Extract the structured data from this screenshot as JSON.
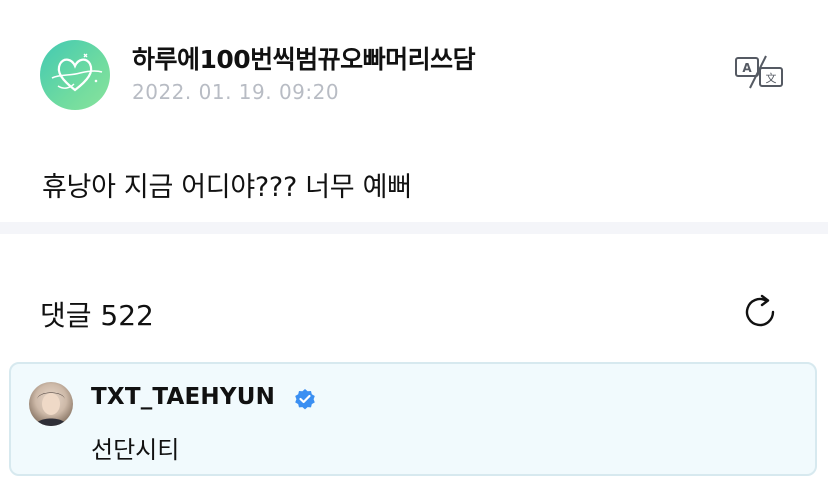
{
  "post": {
    "author": "하루에100번씩범뀨오빠머리쓰담",
    "date": "2022. 01. 19. 09:20",
    "body": "휴낭아 지금 어디야??? 너무 예뻐",
    "translate_icon": "translate-icon"
  },
  "comments": {
    "title": "댓글 522",
    "refresh_icon": "refresh-icon",
    "items": [
      {
        "author": "TXT_TAEHYUN",
        "verified": true,
        "text": "선단시티"
      }
    ]
  },
  "colors": {
    "date_text": "#b8bcc4",
    "verified_badge": "#3b8ff2",
    "comment_bg": "#f1fafd",
    "comment_border": "#d7e9ef",
    "divider": "#f4f5f9",
    "avatar_gradient_start": "#42c9b3",
    "avatar_gradient_end": "#89e39c"
  }
}
